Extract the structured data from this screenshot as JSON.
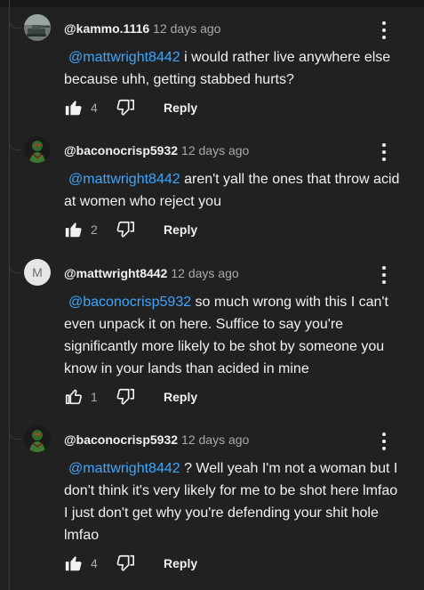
{
  "comments": [
    {
      "author": "@kammo.1116",
      "time": "12 days ago",
      "mention": "@mattwright8442",
      "text": " i would rather live anywhere else because uhh, getting stabbed hurts?",
      "likes": "4",
      "liked": true,
      "reply_label": "Reply",
      "avatar": "tank-avatar"
    },
    {
      "author": "@baconocrisp5932",
      "time": "12 days ago",
      "mention": "@mattwright8442",
      "text": " aren't yall the ones that throw acid at women who reject you",
      "likes": "2",
      "liked": true,
      "reply_label": "Reply",
      "avatar": "green-figure-avatar"
    },
    {
      "author": "@mattwright8442",
      "time": "12 days ago",
      "mention": "@baconocrisp5932",
      "text": " so much wrong with this I can't even unpack it on here. Suffice to say you're significantly more likely to be shot by someone you know in your lands than acided in mine",
      "likes": "1",
      "liked": false,
      "reply_label": "Reply",
      "avatar_letter": "M"
    },
    {
      "author": "@baconocrisp5932",
      "time": "12 days ago",
      "mention": "@mattwright8442",
      "text": " ? Well yeah I'm not a woman but I don't think it's very likely for me to be shot here lmfao I just don't get why you're defending your shit hole lmfao",
      "likes": "4",
      "liked": true,
      "reply_label": "Reply",
      "avatar": "green-figure-avatar"
    }
  ],
  "colors": {
    "background": "#212121",
    "text": "#f1f1f1",
    "meta": "#aaaaaa",
    "mention": "#3ea6ff"
  },
  "icons": [
    "like-icon",
    "dislike-icon",
    "more-options-icon"
  ]
}
